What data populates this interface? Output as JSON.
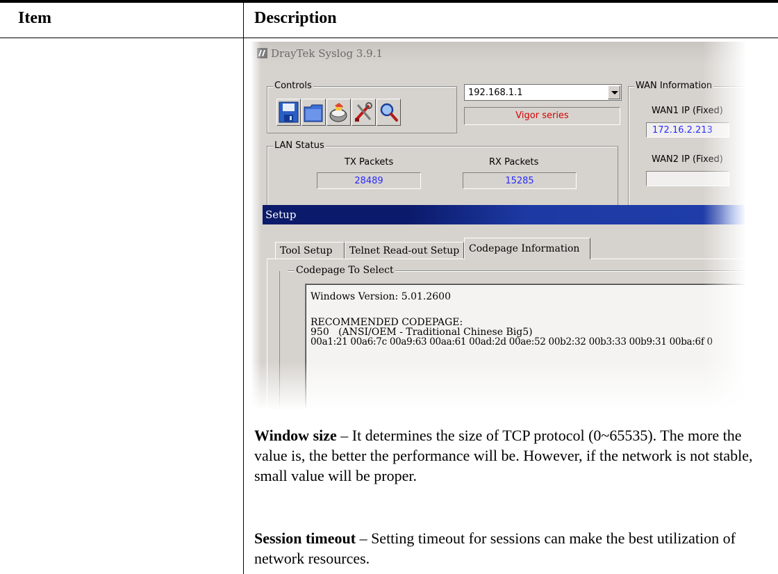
{
  "table": {
    "header_item": "Item",
    "header_description": "Description"
  },
  "screenshot": {
    "window_title": "DrayTek Syslog 3.9.1",
    "controls_label": "Controls",
    "router_ip": "192.168.1.1",
    "router_model": "Vigor series",
    "wan_info_label": "WAN Information",
    "wan1_label": "WAN1 IP (Fixed)",
    "wan1_ip": "172.16.2.213",
    "wan2_label": "WAN2 IP (Fixed)",
    "wan2_ip": "",
    "lan_status_label": "LAN Status",
    "tx_label": "TX Packets",
    "tx_value": "28489",
    "rx_label": "RX Packets",
    "rx_value": "15285",
    "setup_title": "Setup",
    "tabs": [
      "Tool Setup",
      "Telnet Read-out Setup",
      "Codepage Information"
    ],
    "active_tab": "Codepage Information",
    "codepage_group_label": "Codepage To Select",
    "windows_version": "Windows Version: 5.01.2600",
    "recommended_label": "RECOMMENDED CODEPAGE:",
    "codepage": "950   (ANSI/OEM - Traditional Chinese Big5)",
    "codepage_map": "00a1:21 00a6:7c 00a9:63 00aa:61 00ad:2d 00ae:52 00b2:32 00b3:33 00b9:31 00ba:6f 0",
    "colors": {
      "model_text": "#d40000",
      "value_text": "#2a2aff",
      "setup_bar": "#0b1a6a"
    },
    "toolbar_icons": [
      "save-icon",
      "open-folder-icon",
      "clear-log-icon",
      "settings-tools-icon",
      "search-icon"
    ]
  },
  "text": {
    "window_size_term": "Window size",
    "window_size_desc": " – It determines the size of TCP protocol (0~65535). The more the value is, the better the performance will be. However, if the network is not stable, small value will be proper.",
    "session_timeout_term": "Session timeout",
    "session_timeout_desc": " – Setting timeout for sessions can make the best utilization of network resources."
  }
}
